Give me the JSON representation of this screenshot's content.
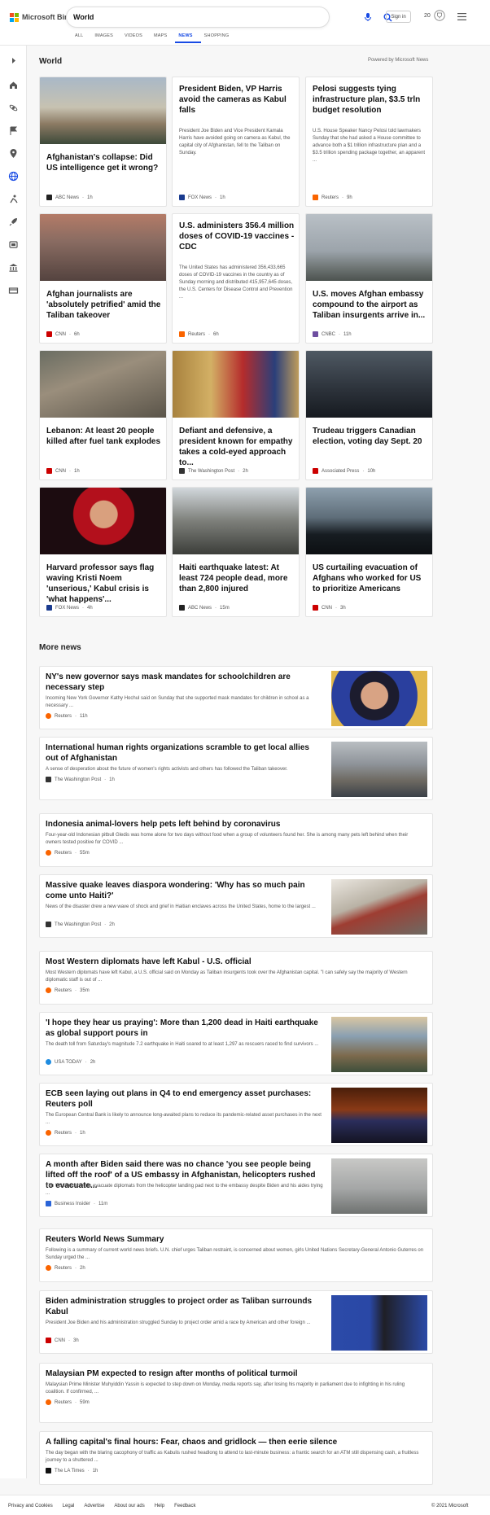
{
  "header": {
    "brand": "Microsoft Bing",
    "query": "World",
    "sign_in": "Sign in",
    "points": "20",
    "tabs": [
      "ALL",
      "IMAGES",
      "VIDEOS",
      "MAPS",
      "NEWS",
      "SHOPPING"
    ],
    "active_tab": "NEWS"
  },
  "section": {
    "title": "World",
    "powered": "Powered by Microsoft News"
  },
  "cards": [
    {
      "title": "Afghanistan's collapse: Did US intelligence get it wrong?",
      "source": "ABC News",
      "age": "1h",
      "has_image": true
    },
    {
      "title": "President Biden, VP Harris avoid the cameras as Kabul falls",
      "snippet": "President Joe Biden and Vice President Kamala Harris have avoided going on camera as Kabul, the capital city of Afghanistan, fell to the Taliban on Sunday.",
      "source": "FOX News",
      "age": "1h",
      "has_image": false
    },
    {
      "title": "Pelosi suggests tying infrastructure plan, $3.5 trln budget resolution",
      "snippet": "U.S. House Speaker Nancy Pelosi told lawmakers Sunday that she had asked a House committee to advance both a $1 trillion infrastructure plan and a $3.5 trillion spending package together, an apparent ...",
      "source": "Reuters",
      "age": "9h",
      "has_image": false
    },
    {
      "title": "Afghan journalists are 'absolutely petrified' amid the Taliban takeover",
      "source": "CNN",
      "age": "6h",
      "has_image": true
    },
    {
      "title": "U.S. administers 356.4 million doses of COVID-19 vaccines - CDC",
      "snippet": "The United States has administered 356,433,665 doses of COVID-19 vaccines in the country as of Sunday morning and distributed 415,957,645 doses, the U.S. Centers for Disease Control and Prevention ...",
      "source": "Reuters",
      "age": "6h",
      "has_image": false
    },
    {
      "title": "U.S. moves Afghan embassy compound to the airport as Taliban insurgents arrive in...",
      "source": "CNBC",
      "age": "11h",
      "has_image": true
    },
    {
      "title": "Lebanon: At least 20 people killed after fuel tank explodes",
      "source": "CNN",
      "age": "1h",
      "has_image": true
    },
    {
      "title": "Defiant and defensive, a president known for empathy takes a cold-eyed approach to...",
      "source": "The Washington Post",
      "age": "2h",
      "has_image": true
    },
    {
      "title": "Trudeau triggers Canadian election, voting day Sept. 20",
      "source": "Associated Press",
      "age": "10h",
      "has_image": true
    },
    {
      "title": "Harvard professor says flag waving Kristi Noem 'unserious,' Kabul crisis is 'what happens'...",
      "source": "FOX News",
      "age": "4h",
      "has_image": true
    },
    {
      "title": "Haiti earthquake latest: At least 724 people dead, more than 2,800 injured",
      "source": "ABC News",
      "age": "15m",
      "has_image": true
    },
    {
      "title": "US curtailing evacuation of Afghans who worked for US to prioritize Americans",
      "source": "CNN",
      "age": "3h",
      "has_image": true
    }
  ],
  "more": {
    "title": "More news",
    "items": [
      {
        "title": "NY's new governor says mask mandates for schoolchildren are necessary step",
        "snippet": "Incoming New York Governor Kathy Hochul said on Sunday that she supported mask mandates for children in school as a necessary ...",
        "source": "Reuters",
        "age": "11h"
      },
      {
        "title": "International human rights organizations scramble to get local allies out of Afghanistan",
        "snippet": "A sense of desperation about the future of women's rights activists and others has followed the Taliban takeover.",
        "source": "The Washington Post",
        "age": "1h"
      },
      {
        "title": "Indonesia animal-lovers help pets left behind by coronavirus",
        "snippet": "Four-year-old Indonesian pitbull Gledis was home alone for two days without food when a group of volunteers found her. She is among many pets left behind when their owners tested positive for COVID ...",
        "source": "Reuters",
        "age": "55m"
      },
      {
        "title": "Massive quake leaves diaspora wondering: 'Why has so much pain come unto Haiti?'",
        "snippet": "News of the disaster drew a new wave of shock and grief in Haitian enclaves across the United States, home to the largest ...",
        "source": "The Washington Post",
        "age": "2h"
      },
      {
        "title": "Most Western diplomats have left Kabul - U.S. official",
        "snippet": "Most Western diplomats have left Kabul, a U.S. official said on Monday as Taliban insurgents took over the Afghanistan capital. \"I can safely say the majority of Western diplomatic staff is out of ...",
        "source": "Reuters",
        "age": "35m"
      },
      {
        "title": "'I hope they hear us praying': More than 1,200 dead in Haiti earthquake as global support pours in",
        "snippet": "The death toll from Saturday's magnitude 7.2 earthquake in Haiti soared to at least 1,297 as rescuers raced to find survivors ...",
        "source": "USA TODAY",
        "age": "2h"
      },
      {
        "title": "ECB seen laying out plans in Q4 to end emergency asset purchases: Reuters poll",
        "snippet": "The European Central Bank is likely to announce long-awaited plans to reduce its pandemic-related asset purchases in the next ...",
        "source": "Reuters",
        "age": "1h"
      },
      {
        "title": "A month after Biden said there was no chance 'you see people being lifted off the roof' of a US embassy in Afghanistan, helicopters rushed to evacuate...",
        "snippet": "The US scrambled to evacuate diplomats from the helicopter landing pad next to the embassy despite Biden and his aides trying ...",
        "source": "Business Insider",
        "age": "11m"
      },
      {
        "title": "Reuters World News Summary",
        "snippet": "Following is a summary of current world news briefs. U.N. chief urges Taliban restraint, is concerned about women, girls United Nations Secretary-General Antonio Guterres on Sunday urged the ...",
        "source": "Reuters",
        "age": "2h"
      },
      {
        "title": "Biden administration struggles to project order as Taliban surrounds Kabul",
        "snippet": "President Joe Biden and his administration struggled Sunday to project order amid a race by American and other foreign ...",
        "source": "CNN",
        "age": "3h"
      },
      {
        "title": "Malaysian PM expected to resign after months of political turmoil",
        "snippet": "Malaysian Prime Minister Muhyiddin Yassin is expected to step down on Monday, media reports say, after losing his majority in parliament due to infighting in his ruling coalition. If confirmed, ...",
        "source": "Reuters",
        "age": "59m"
      },
      {
        "title": "A falling capital's final hours: Fear, chaos and gridlock — then eerie silence",
        "snippet": "The day began with the blaring cacophony of traffic as Kabulis rushed headlong to attend to last-minute business: a frantic search for an ATM still dispensing cash, a fruitless journey to a shuttered ...",
        "source": "The LA Times",
        "age": "1h"
      }
    ]
  },
  "footer": {
    "links": [
      "Privacy and Cookies",
      "Legal",
      "Advertise",
      "About our ads",
      "Help",
      "Feedback"
    ],
    "copyright": "© 2021 Microsoft"
  },
  "colors": {
    "accent": "#174ae4",
    "reuters": "#fa6400",
    "cnn": "#cc0000"
  }
}
